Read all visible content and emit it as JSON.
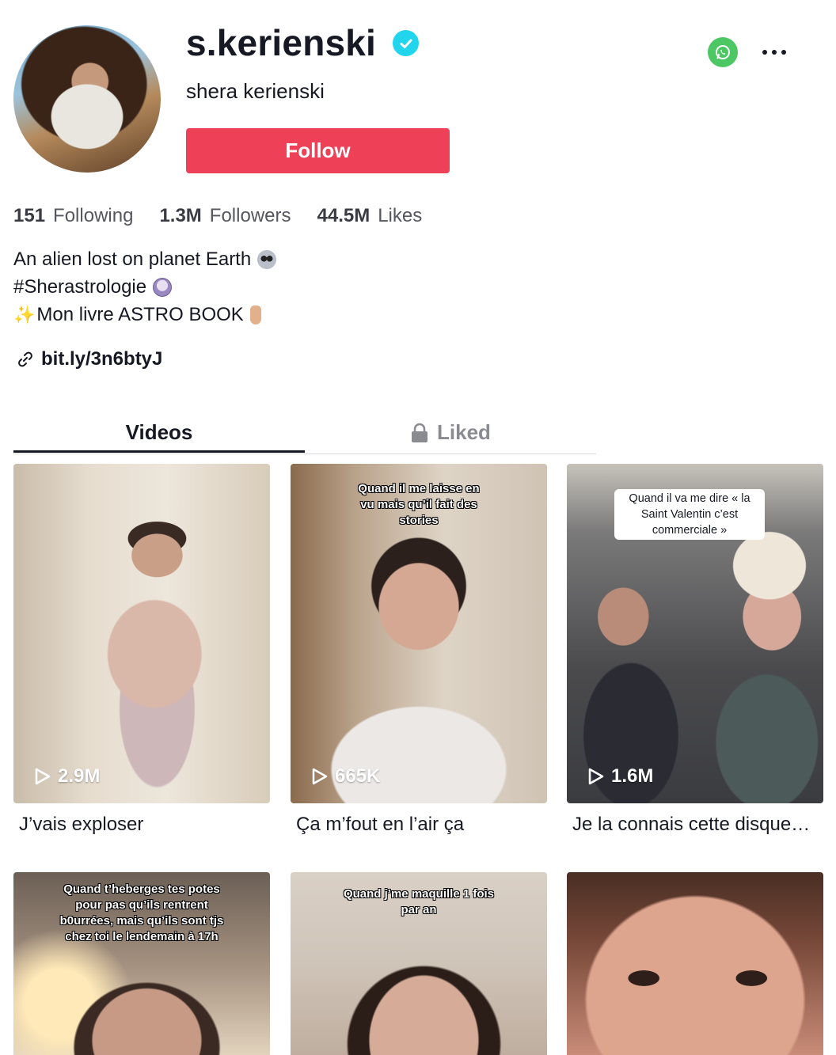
{
  "profile": {
    "username": "s.kerienski",
    "nickname": "shera kerienski",
    "follow_label": "Follow",
    "verified_icon": "verified-check-icon"
  },
  "stats": [
    {
      "value": "151",
      "label": "Following"
    },
    {
      "value": "1.3M",
      "label": "Followers"
    },
    {
      "value": "44.5M",
      "label": "Likes"
    }
  ],
  "bio": {
    "line1": "An alien lost on planet Earth",
    "line2": "#Sherastrologie",
    "line3": "Mon livre ASTRO BOOK",
    "link": "bit.ly/3n6btyJ"
  },
  "tabs": {
    "videos": "Videos",
    "liked": "Liked"
  },
  "videos": [
    {
      "views": "2.9M",
      "caption": "J’vais exploser",
      "overlay": ""
    },
    {
      "views": "665K",
      "caption": "Ça m’fout en l’air ça",
      "overlay": "Quand il me laisse en vu mais qu’il fait des stories"
    },
    {
      "views": "1.6M",
      "caption": "Je la connais cette disque…",
      "overlay": "Quand il va me dire « la Saint Valentin c’est commerciale »"
    },
    {
      "views": "",
      "caption": "",
      "overlay": "Quand t’heberges tes potes pour pas qu’ils rentrent b0urrées, mais qu’ils sont tjs chez toi le lendemain à 17h"
    },
    {
      "views": "",
      "caption": "",
      "overlay": "Quand j’me maquille 1 fois par an"
    },
    {
      "views": "",
      "caption": "",
      "overlay": ""
    }
  ],
  "colors": {
    "follow": "#ee4057",
    "verified": "#20d5ec",
    "whatsapp": "#4cc764",
    "text": "#161823"
  }
}
